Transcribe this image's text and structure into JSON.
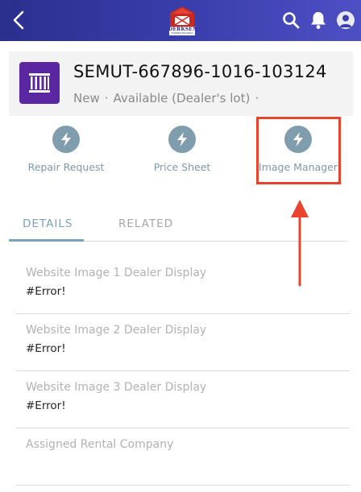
{
  "app": {
    "brand_text": "DERKSEN",
    "brand_subtext": "PORTABLE BUILDINGS"
  },
  "record": {
    "title": "SEMUT-667896-1016-103124",
    "status": "New",
    "availability": "Available (Dealer's lot)",
    "separator": "·"
  },
  "actions": [
    {
      "label": "Repair Request"
    },
    {
      "label": "Price Sheet"
    },
    {
      "label": "Image Manager"
    }
  ],
  "tabs": [
    {
      "label": "DETAILS",
      "active": true
    },
    {
      "label": "RELATED",
      "active": false
    }
  ],
  "fields": [
    {
      "label": "Website Image 1 Dealer Display",
      "value": "#Error!"
    },
    {
      "label": "Website Image 2 Dealer Display",
      "value": "#Error!"
    },
    {
      "label": "Website Image 3 Dealer Display",
      "value": "#Error!"
    },
    {
      "label": "Assigned Rental Company",
      "value": ""
    }
  ],
  "colors": {
    "nav": "#3b3fae",
    "record_icon": "#5b26a2",
    "action_icon": "#7f9dad",
    "highlight": "#e8432d",
    "tab_active": "#7aa3bb"
  },
  "icons": {
    "back": "chevron-left-icon",
    "logo": "barn-logo-icon",
    "search": "search-icon",
    "notifications": "bell-icon",
    "avatar": "user-avatar-icon",
    "record": "building-record-icon",
    "action": "lightning-bolt-icon"
  }
}
